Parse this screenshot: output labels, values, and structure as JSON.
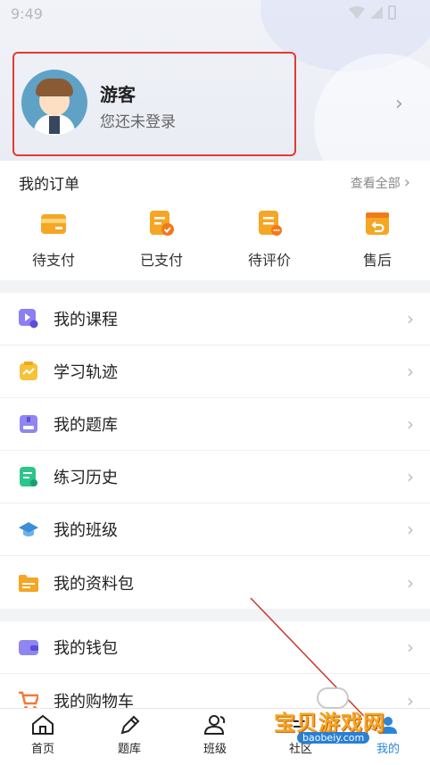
{
  "status_bar": {
    "time": "9:49"
  },
  "profile": {
    "name": "游客",
    "hint": "您还未登录"
  },
  "orders": {
    "title": "我的订单",
    "view_all": "查看全部",
    "items": [
      {
        "label": "待支付",
        "icon": "wallet-card-icon"
      },
      {
        "label": "已支付",
        "icon": "paid-check-icon"
      },
      {
        "label": "待评价",
        "icon": "review-doc-icon"
      },
      {
        "label": "售后",
        "icon": "return-box-icon"
      }
    ]
  },
  "menu_group1": [
    {
      "label": "我的课程",
      "icon": "course-play-icon",
      "color": "#8b7ff5"
    },
    {
      "label": "学习轨迹",
      "icon": "trace-chart-icon",
      "color": "#f6c23a"
    },
    {
      "label": "我的题库",
      "icon": "question-bank-icon",
      "color": "#8f86f2"
    },
    {
      "label": "练习历史",
      "icon": "history-doc-icon",
      "color": "#2cc58a"
    },
    {
      "label": "我的班级",
      "icon": "graduation-cap-icon",
      "color": "#3a8fd9"
    },
    {
      "label": "我的资料包",
      "icon": "folder-icon",
      "color": "#f5a623"
    }
  ],
  "menu_group2": [
    {
      "label": "我的钱包",
      "icon": "wallet-icon",
      "color": "#8f86f2"
    },
    {
      "label": "我的购物车",
      "icon": "cart-icon",
      "color": "#f07a3a"
    }
  ],
  "tabbar": [
    {
      "label": "首页",
      "icon": "home-icon"
    },
    {
      "label": "题库",
      "icon": "pen-icon"
    },
    {
      "label": "班级",
      "icon": "class-users-icon"
    },
    {
      "label": "社区",
      "icon": "community-icon"
    },
    {
      "label": "我的",
      "icon": "me-icon"
    }
  ],
  "watermark": {
    "text": "宝贝游戏网",
    "url": "baobeiy.com"
  },
  "colors": {
    "accent": "#2a86d9",
    "highlight_border": "#e23a35",
    "order_icon": "#f5a623"
  }
}
